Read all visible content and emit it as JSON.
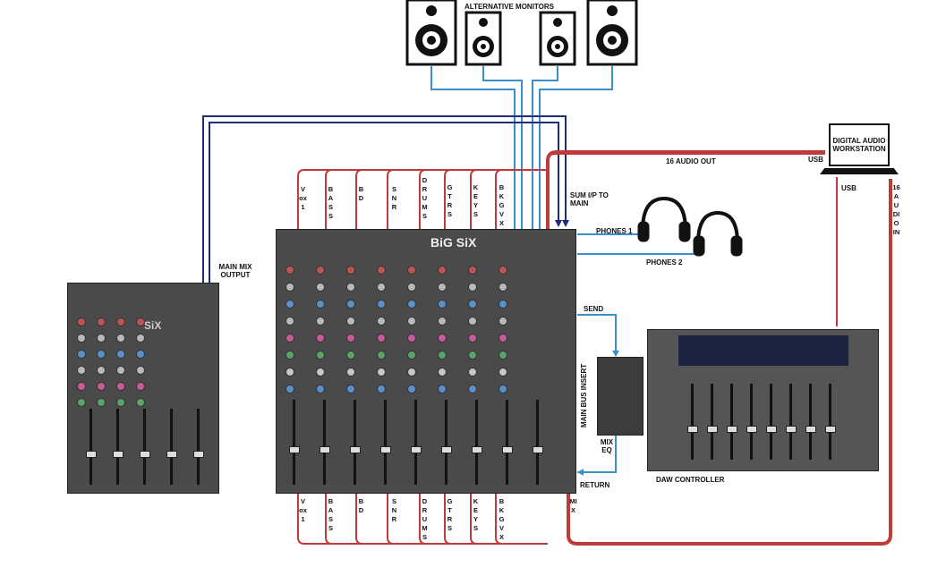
{
  "labels": {
    "alt_monitors": "ALTERNATIVE MONITORS",
    "daw": "DIGITAL AUDIO WORKSTATION",
    "audio_out": "16 AUDIO OUT",
    "usb_top": "USB",
    "usb_bottom": "USB",
    "audio_in": "16 AUDIO IN",
    "sum_ip": "SUM I/P TO MAIN",
    "phones1": "PHONES 1",
    "phones2": "PHONES 2",
    "main_mix_output": "MAIN MIX OUTPUT",
    "send": "SEND",
    "return": "RETURN",
    "main_bus_insert": "MAIN BUS INSERT",
    "mix_eq": "MIX EQ",
    "daw_controller": "DAW CONTROLLER",
    "mix": "MIX",
    "console_logo": "BiG SiX",
    "small_console_logo": "SiX"
  },
  "channels": [
    "Vox 1",
    "BASS",
    "BD",
    "SNR",
    "DRUMS",
    "GTRS",
    "KEYS",
    "BKGVX"
  ],
  "colors": {
    "red_wire": "#c0393b",
    "light_blue_wire": "#3a8fd0",
    "navy_wire": "#1e2c7a",
    "console_body": "#4a4a4a"
  }
}
